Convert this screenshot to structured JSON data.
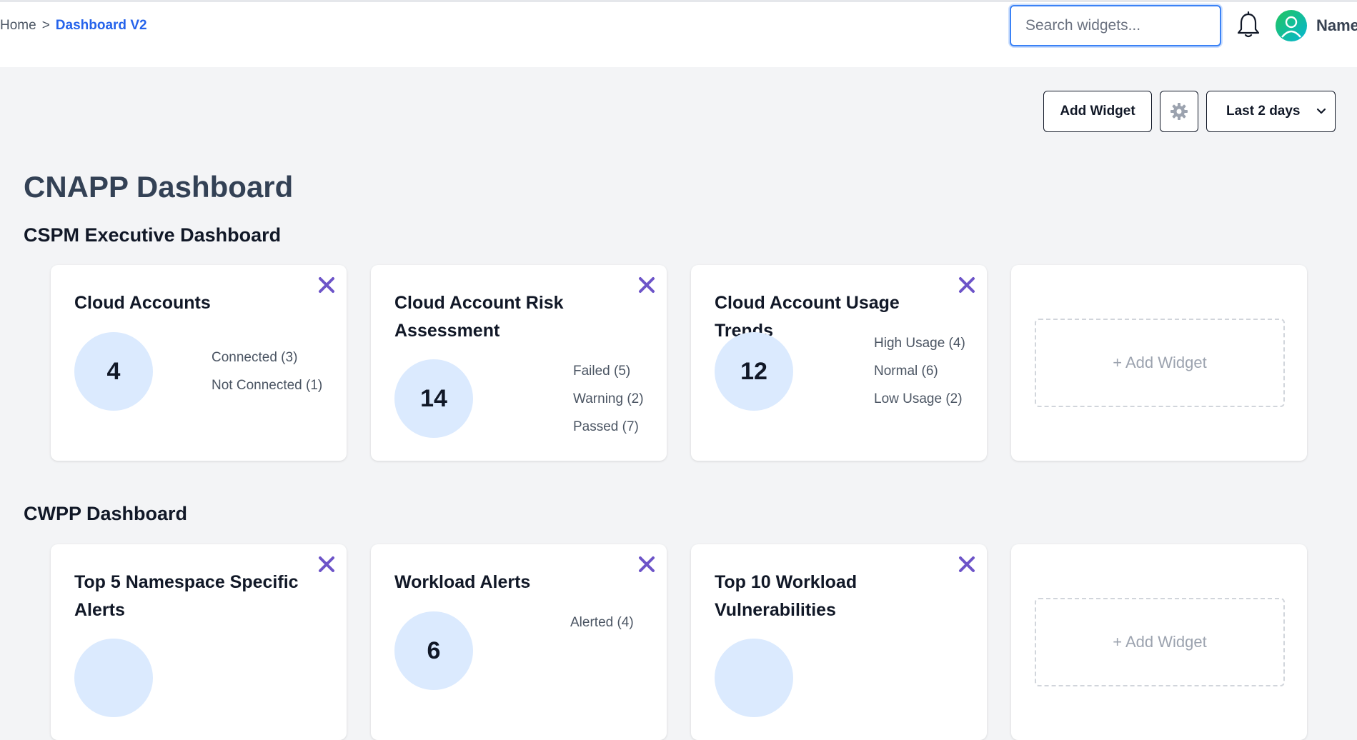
{
  "breadcrumb": {
    "home": "Home",
    "separator": ">",
    "current": "Dashboard V2"
  },
  "header": {
    "search_placeholder": "Search widgets...",
    "user_name": "Name"
  },
  "toolbar": {
    "add_widget_label": "Add Widget",
    "time_range": "Last 2 days"
  },
  "page_title": "CNAPP Dashboard",
  "sections": [
    {
      "title": "CSPM Executive Dashboard",
      "widgets": [
        {
          "title": "Cloud Accounts",
          "total": "4",
          "legend": [
            "Connected (3)",
            "Not Connected (1)"
          ]
        },
        {
          "title": "Cloud Account Risk Assessment",
          "total": "14",
          "legend": [
            "Failed (5)",
            "Warning (2)",
            "Passed (7)"
          ]
        },
        {
          "title": "Cloud Account Usage Trends",
          "total": "12",
          "legend": [
            "High Usage (4)",
            "Normal (6)",
            "Low Usage (2)"
          ]
        }
      ],
      "add_widget_label": "+ Add Widget"
    },
    {
      "title": "CWPP Dashboard",
      "widgets": [
        {
          "title": "Top 5 Namespace Specific Alerts"
        },
        {
          "title": "Workload Alerts",
          "total": "6",
          "legend": [
            "Alerted (4)"
          ]
        },
        {
          "title": "Top 10 Workload Vulnerabilities"
        }
      ],
      "add_widget_label": "+ Add Widget"
    }
  ],
  "colors": {
    "accent": "#2563eb",
    "close_icon": "#6d54c8",
    "circle_fill": "#dbeafe"
  }
}
